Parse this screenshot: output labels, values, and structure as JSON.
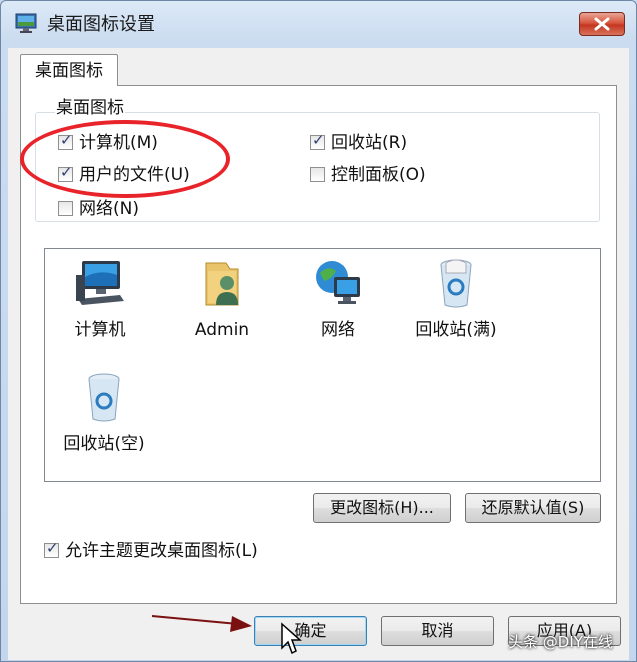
{
  "window": {
    "title": "桌面图标设置"
  },
  "tab": {
    "label": "桌面图标"
  },
  "group": {
    "label": "桌面图标"
  },
  "checkboxes": [
    {
      "label": "计算机(M)",
      "checked": true
    },
    {
      "label": "回收站(R)",
      "checked": true
    },
    {
      "label": "用户的文件(U)",
      "checked": true
    },
    {
      "label": "控制面板(O)",
      "checked": false
    },
    {
      "label": "网络(N)",
      "checked": false
    }
  ],
  "icons": [
    {
      "label": "计算机",
      "icon": "computer-icon"
    },
    {
      "label": "Admin",
      "icon": "user-folder-icon"
    },
    {
      "label": "网络",
      "icon": "network-icon"
    },
    {
      "label": "回收站(满)",
      "icon": "recycle-bin-full-icon"
    },
    {
      "label": "回收站(空)",
      "icon": "recycle-bin-empty-icon"
    }
  ],
  "buttons": {
    "change_icon": "更改图标(H)...",
    "restore_default": "还原默认值(S)",
    "ok": "确定",
    "cancel": "取消",
    "apply": "应用(A)"
  },
  "allow_themes": {
    "label": "允许主题更改桌面图标(L)",
    "checked": true
  },
  "watermark": "头条 @DIY在线",
  "colors": {
    "annotation": "#e8232a",
    "arrow": "#7a1010"
  }
}
